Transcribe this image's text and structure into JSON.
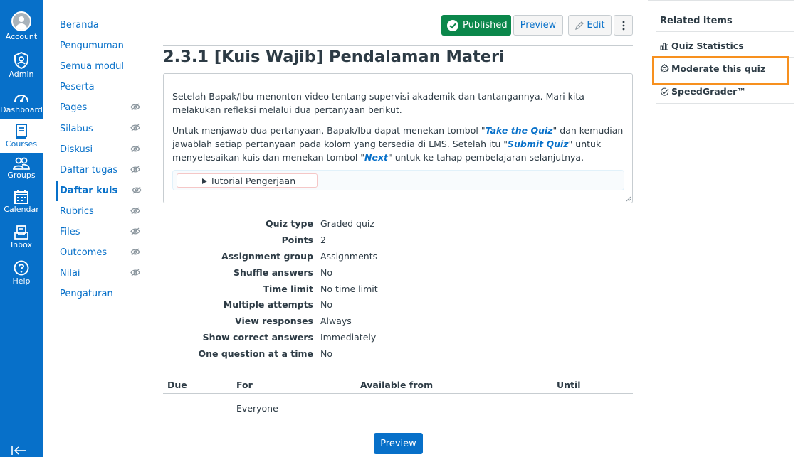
{
  "global_nav": {
    "items": [
      {
        "label": "Account",
        "icon": "user-avatar-icon"
      },
      {
        "label": "Admin",
        "icon": "shield-icon"
      },
      {
        "label": "Dashboard",
        "icon": "dashboard-gauge-icon"
      },
      {
        "label": "Courses",
        "icon": "book-icon",
        "active": true
      },
      {
        "label": "Groups",
        "icon": "groups-icon"
      },
      {
        "label": "Calendar",
        "icon": "calendar-icon"
      },
      {
        "label": "Inbox",
        "icon": "inbox-icon"
      },
      {
        "label": "Help",
        "icon": "help-icon"
      }
    ],
    "colors": {
      "background": "#0770c9",
      "active_bg": "#ffffff"
    }
  },
  "course_nav": {
    "items": [
      {
        "label": "Beranda",
        "hidden": false
      },
      {
        "label": "Pengumuman",
        "hidden": false
      },
      {
        "label": "Semua modul",
        "hidden": false
      },
      {
        "label": "Peserta",
        "hidden": false
      },
      {
        "label": "Pages",
        "hidden": true
      },
      {
        "label": "Silabus",
        "hidden": true
      },
      {
        "label": "Diskusi",
        "hidden": true
      },
      {
        "label": "Daftar tugas",
        "hidden": true
      },
      {
        "label": "Daftar kuis",
        "hidden": true,
        "active": true
      },
      {
        "label": "Rubrics",
        "hidden": true
      },
      {
        "label": "Files",
        "hidden": true
      },
      {
        "label": "Outcomes",
        "hidden": true
      },
      {
        "label": "Nilai",
        "hidden": true
      },
      {
        "label": "Pengaturan",
        "hidden": false
      }
    ]
  },
  "header": {
    "published_label": "Published",
    "preview_label": "Preview",
    "edit_label": "Edit",
    "colors": {
      "published": "#0b874b",
      "link": "#0770c9"
    }
  },
  "quiz": {
    "title": "2.3.1 [Kuis Wajib] Pendalaman Materi",
    "description": {
      "p1": "Setelah Bapak/Ibu menonton video tentang supervisi akademik dan tantangannya. Mari kita melakukan refleksi melalui dua pertanyaan berikut.",
      "p2_a": "Untuk menjawab dua pertanyaan, Bapak/Ibu dapat menekan tombol \"",
      "p2_take": "Take the Quiz",
      "p2_b": "\" dan kemudian jawablah setiap pertanyaan pada kolom yang tersedia di LMS. Setelah itu \"",
      "p2_submit": "Submit Quiz",
      "p2_c": "\" untuk menyelesaikan kuis dan menekan tombol \"",
      "p2_next": "Next",
      "p2_d": "\" untuk ke tahap pembelajaran selanjutnya.",
      "details_summary": "Tutorial Pengerjaan"
    },
    "details": [
      {
        "label": "Quiz type",
        "value": "Graded quiz"
      },
      {
        "label": "Points",
        "value": "2"
      },
      {
        "label": "Assignment group",
        "value": "Assignments"
      },
      {
        "label": "Shuffle answers",
        "value": "No"
      },
      {
        "label": "Time limit",
        "value": "No time limit"
      },
      {
        "label": "Multiple attempts",
        "value": "No"
      },
      {
        "label": "View responses",
        "value": "Always"
      },
      {
        "label": "Show correct answers",
        "value": "Immediately"
      },
      {
        "label": "One question at a time",
        "value": "No"
      }
    ]
  },
  "due_table": {
    "headers": [
      "Due",
      "For",
      "Available from",
      "Until"
    ],
    "rows": [
      [
        "-",
        "Everyone",
        "-",
        "-"
      ]
    ]
  },
  "preview_bottom_label": "Preview",
  "related": {
    "title": "Related items",
    "items": [
      {
        "label": "Quiz Statistics",
        "icon": "bar-chart-icon"
      },
      {
        "label": "Moderate this quiz",
        "icon": "gear-icon",
        "highlighted": true
      },
      {
        "label": "SpeedGrader™",
        "icon": "speedgrader-check-icon"
      }
    ],
    "highlight_color": "#f7901e"
  }
}
